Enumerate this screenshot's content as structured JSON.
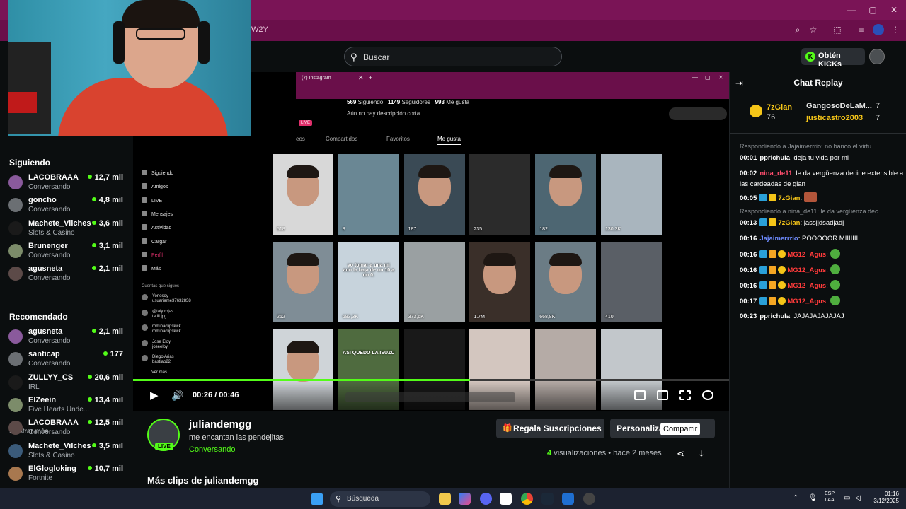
{
  "browser": {
    "url_fragment": "W2Y",
    "window_controls": [
      "—",
      "▢",
      "✕"
    ]
  },
  "header": {
    "search_placeholder": "Buscar",
    "get_kicks_label": "Obtén KICKs"
  },
  "sidebar": {
    "following_title": "Siguiendo",
    "following": [
      {
        "name": "LACOBRAAA",
        "sub": "Conversando",
        "viewers": "12,7 mil"
      },
      {
        "name": "goncho",
        "sub": "Conversando",
        "viewers": "4,8 mil"
      },
      {
        "name": "Machete_Vilches",
        "sub": "Slots & Casino",
        "viewers": "3,6 mil"
      },
      {
        "name": "Brunenger",
        "sub": "Conversando",
        "viewers": "3,1 mil"
      },
      {
        "name": "agusneta",
        "sub": "Conversando",
        "viewers": "2,1 mil"
      }
    ],
    "show_more": "Mostrar más",
    "recommended_title": "Recomendado",
    "recommended": [
      {
        "name": "agusneta",
        "sub": "Conversando",
        "viewers": "2,1 mil"
      },
      {
        "name": "santicap",
        "sub": "Conversando",
        "viewers": "177"
      },
      {
        "name": "ZULLYY_CS",
        "sub": "IRL",
        "viewers": "20,6 mil"
      },
      {
        "name": "ElZeein",
        "sub": "Five Hearts Unde...",
        "viewers": "13,4 mil"
      },
      {
        "name": "LACOBRAAA",
        "sub": "Conversando",
        "viewers": "12,5 mil"
      },
      {
        "name": "Machete_Vilches",
        "sub": "Slots & Casino",
        "viewers": "3,5 mil"
      },
      {
        "name": "ElGlogloking",
        "sub": "Fortnite",
        "viewers": "10,7 mil"
      }
    ]
  },
  "video": {
    "inner_tab": "(7) Instagram",
    "ig_stats": {
      "following": "569",
      "following_label": "Siguiendo",
      "followers": "1149",
      "followers_label": "Seguidores",
      "likes": "993",
      "likes_label": "Me gusta"
    },
    "ig_nodesc": "Aún no hay descripción corta.",
    "ig_live": "LIVE",
    "ig_tabs": [
      "eos",
      "Compartidos",
      "Favoritos",
      "Me gusta"
    ],
    "ig_nav": [
      "Siguiendo",
      "Amigos",
      "LIVE",
      "Mensajes",
      "Actividad",
      "Cargar",
      "Perfil",
      "Más"
    ],
    "ig_suggest_title": "Cuentas que sigues",
    "ig_suggest": [
      {
        "n": "Yonosoy",
        "h": "usuariame37632838"
      },
      {
        "n": "@taly rojas",
        "h": "tatiii.jpg"
      },
      {
        "n": "rominaclipskick",
        "h": "rominaclipskick"
      },
      {
        "n": "Jose Eloy",
        "h": "joseeloy"
      },
      {
        "n": "Diego Arias",
        "h": "bastiao22"
      }
    ],
    "ig_see_more": "Ver más",
    "thumbs": [
      {
        "count": "518",
        "cap": ""
      },
      {
        "count": "8",
        "cap": ""
      },
      {
        "count": "187",
        "cap": ""
      },
      {
        "count": "235",
        "cap": ""
      },
      {
        "count": "182",
        "cap": ""
      },
      {
        "count": "130,3K",
        "cap": ""
      },
      {
        "count": "252",
        "cap": ""
      },
      {
        "count": "683,3K",
        "cap": "yo tomar a una mi aun la baja de un 10 a un 0."
      },
      {
        "count": "373,6K",
        "cap": ""
      },
      {
        "count": "1.7M",
        "cap": ""
      },
      {
        "count": "668,8K",
        "cap": ""
      },
      {
        "count": "410",
        "cap": ""
      },
      {
        "count": "",
        "cap": ""
      },
      {
        "count": "",
        "cap": "ASI QUEDO LA ISUZU"
      },
      {
        "count": "",
        "cap": ""
      },
      {
        "count": "",
        "cap": ""
      },
      {
        "count": "",
        "cap": ""
      },
      {
        "count": "",
        "cap": ""
      }
    ],
    "progress": 0.565,
    "time": "00:26 / 00:46"
  },
  "stream": {
    "channel": "juliandemgg",
    "live_badge": "LIVE",
    "title": "me encantan las pendejitas",
    "category": "Conversando",
    "gift_button": "Regala Suscripciones",
    "custom_button": "Personalizar",
    "tooltip": "Compartir",
    "views_count": "4",
    "views_label": "visualizaciones",
    "ago": "hace 2 meses",
    "more_clips": "Más clips de juliandemgg"
  },
  "chat": {
    "title": "Chat Replay",
    "leaders": [
      {
        "name": "7zGian",
        "count": "76",
        "color": "#f5c518"
      },
      {
        "name": "GangosoDeLaM...",
        "count": "7",
        "color": "#e6e6e6"
      },
      {
        "name": "justicastro2003",
        "count": "7",
        "color": "#f5c518"
      }
    ],
    "messages": [
      {
        "reply": "Respondiendo a Jajaimerrrio: no banco el virtu..."
      },
      {
        "time": "00:01",
        "user": "pprichula",
        "color": "#ffffff",
        "text": "deja tu vida por mi"
      },
      {
        "time": "00:02",
        "user": "nina_de11",
        "color": "#ff4d6d",
        "text": "le da vergüenza decirle extensible a las cardeadas de gian"
      },
      {
        "time": "00:05",
        "user": "7zGian",
        "color": "#f5c518",
        "text": ""
      },
      {
        "reply": "Respondiendo a nina_de11: le da vergüenza dec..."
      },
      {
        "time": "00:13",
        "user": "7zGian",
        "color": "#f5c518",
        "text": "jassjjdsadjadj"
      },
      {
        "time": "00:16",
        "user": "Jajaimerrrio",
        "color": "#6e8bff",
        "text": "POOOOOR MIIIIIII"
      },
      {
        "time": "00:16",
        "user": "MG12_Agus",
        "color": "#ff3b3b",
        "text": ""
      },
      {
        "time": "00:16",
        "user": "MG12_Agus",
        "color": "#ff3b3b",
        "text": ""
      },
      {
        "time": "00:16",
        "user": "MG12_Agus",
        "color": "#ff3b3b",
        "text": ""
      },
      {
        "time": "00:17",
        "user": "MG12_Agus",
        "color": "#ff3b3b",
        "text": ""
      },
      {
        "time": "00:23",
        "user": "pprichula",
        "color": "#ffffff",
        "text": "JAJAJAJAJAJAJ"
      }
    ]
  },
  "taskbar": {
    "search": "Búsqueda",
    "lang_top": "ESP",
    "lang_bottom": "LAA",
    "time": "01:16",
    "date": "3/12/2025"
  }
}
